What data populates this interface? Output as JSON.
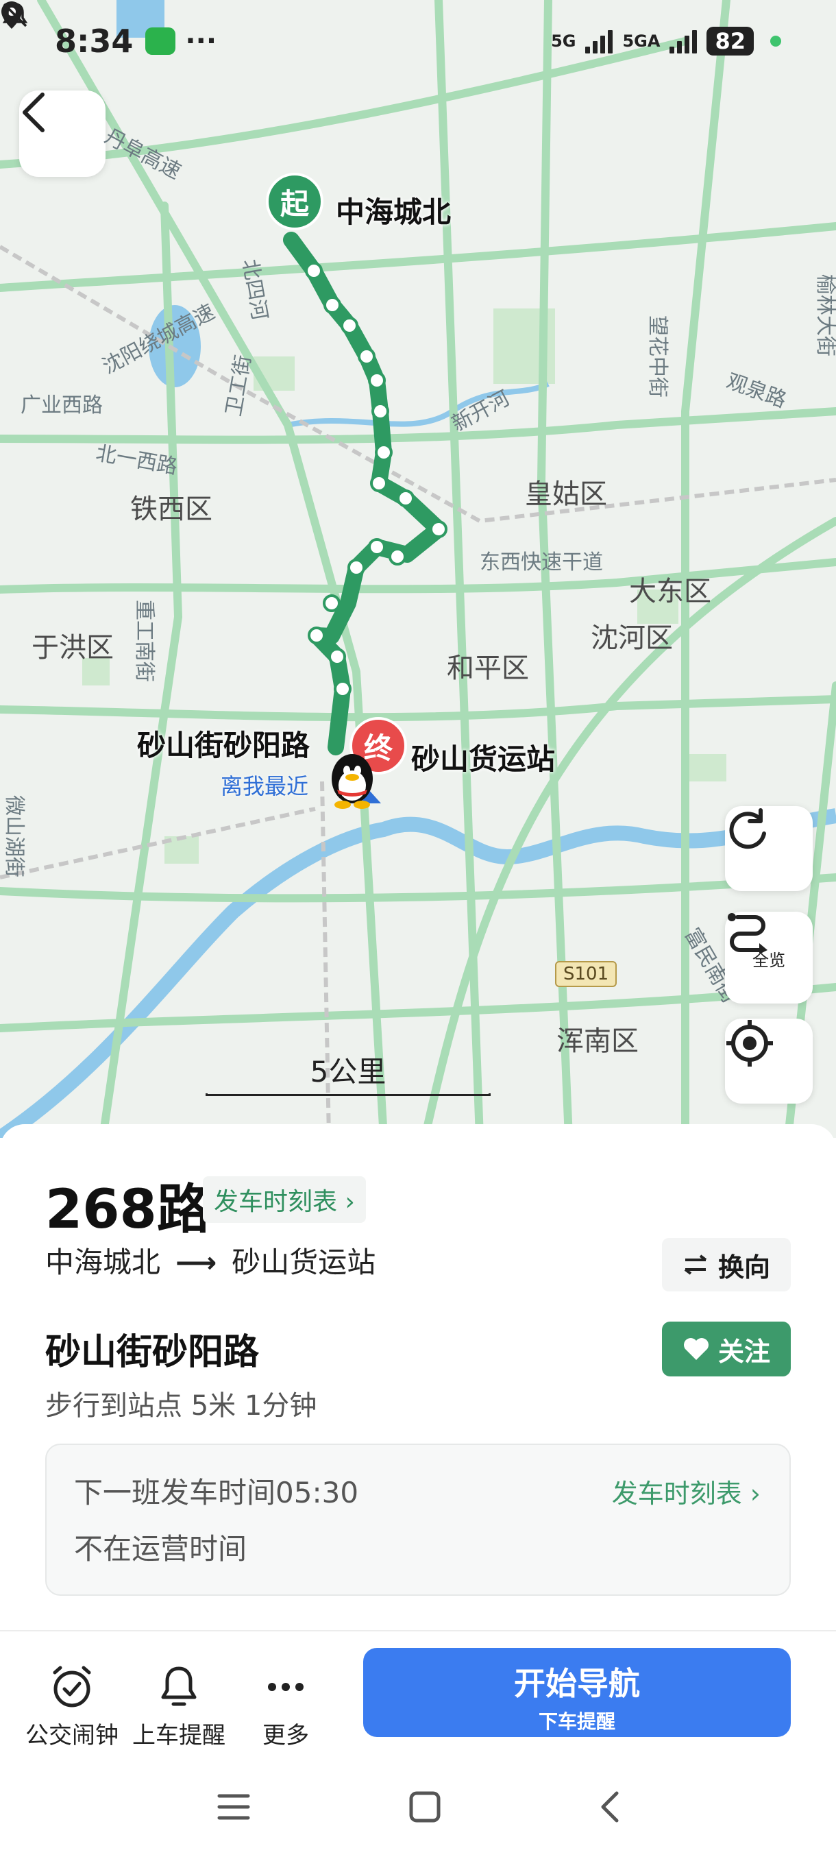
{
  "status_bar": {
    "time": "8:34",
    "dots": "···",
    "signal_1": "5G",
    "signal_2": "5GA",
    "battery": "82"
  },
  "map": {
    "districts": [
      "铁西区",
      "皇姑区",
      "大东区",
      "沈河区",
      "和平区",
      "于洪区",
      "浑南区"
    ],
    "roads": [
      "丹阜高速",
      "北四河",
      "沈阳绕城高速",
      "卫工街",
      "广业西路",
      "北一西路",
      "新开河",
      "东西快速干道",
      "望花中街",
      "观泉路",
      "榆林大街",
      "重工南街",
      "微山湖街",
      "富民南街"
    ],
    "highway_badge": "S101",
    "start_pin": "起",
    "end_pin": "终",
    "start_label": "中海城北",
    "end_label": "砂山货运站",
    "current_stop_label": "砂山街砂阳路",
    "nearest_label": "离我最近",
    "scale_label": "5公里",
    "overview_label": "全览",
    "colors": {
      "route": "#2e9a62",
      "water": "#8fc8ea",
      "road": "#a9dcb6",
      "park": "#cfe9cf"
    }
  },
  "sheet": {
    "route_name": "268路",
    "timetable_chip": "发车时刻表 ›",
    "from": "中海城北",
    "arrow": "⟶",
    "to": "砂山货运站",
    "swap_label": "换向",
    "stop_name": "砂山街砂阳路",
    "follow_label": "关注",
    "walk_info": "步行到站点 5米 1分钟",
    "next_departure": "下一班发车时间05:30",
    "timetable_link": "发车时刻表 ›",
    "operation_status": "不在运营时间"
  },
  "actions": {
    "alarm": "公交闹钟",
    "reminder": "上车提醒",
    "more": "更多",
    "nav_main": "开始导航",
    "nav_sub": "下车提醒"
  }
}
